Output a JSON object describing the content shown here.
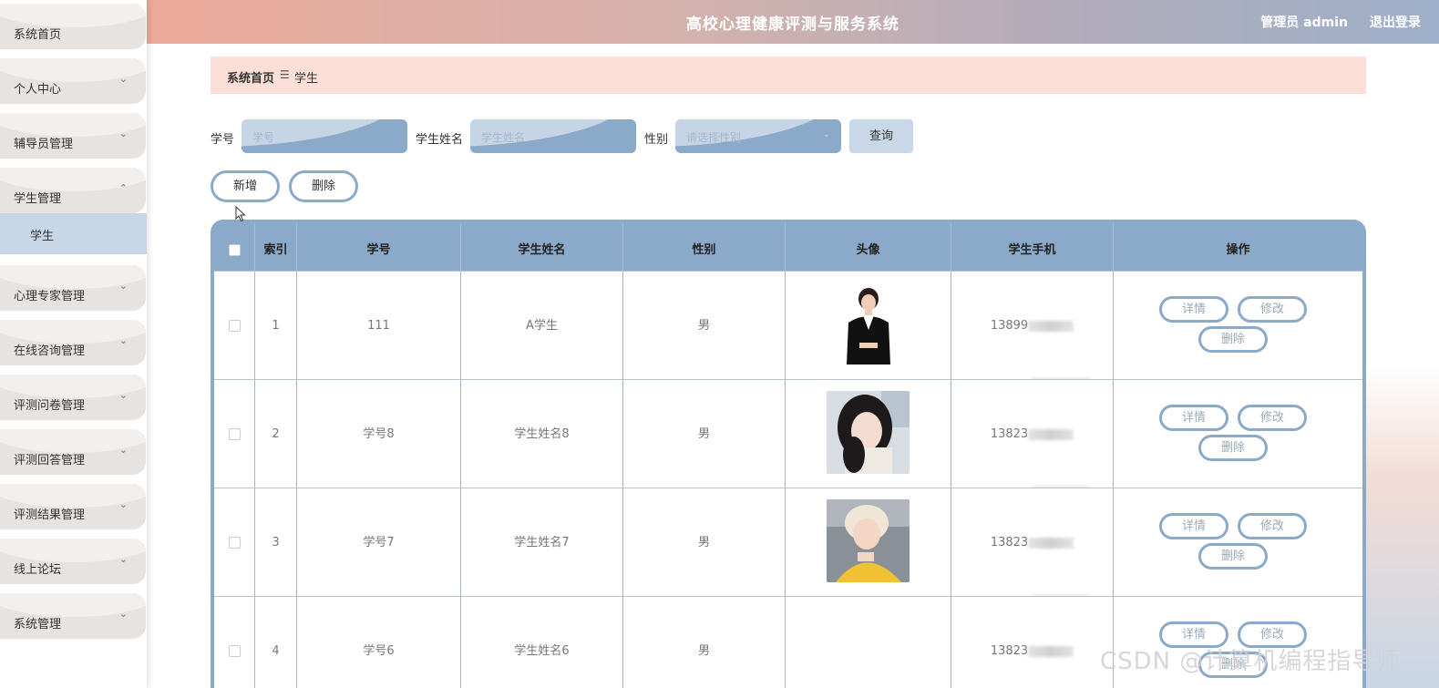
{
  "header": {
    "title": "高校心理健康评测与服务系统",
    "user": "管理员 admin",
    "logout": "退出登录"
  },
  "sidebar": {
    "items": [
      {
        "label": "系统首页",
        "chevron": ""
      },
      {
        "label": "个人中心",
        "chevron": "⌄"
      },
      {
        "label": "辅导员管理",
        "chevron": "⌄"
      },
      {
        "label": "学生管理",
        "chevron": "⌃"
      },
      {
        "label": "心理专家管理",
        "chevron": "⌄"
      },
      {
        "label": "在线咨询管理",
        "chevron": "⌄"
      },
      {
        "label": "评测问卷管理",
        "chevron": "⌄"
      },
      {
        "label": "评测回答管理",
        "chevron": "⌄"
      },
      {
        "label": "评测结果管理",
        "chevron": "⌄"
      },
      {
        "label": "线上论坛",
        "chevron": "⌄"
      },
      {
        "label": "系统管理",
        "chevron": "⌄"
      }
    ],
    "submenu": {
      "label": "学生"
    }
  },
  "breadcrumb": {
    "home": "系统首页",
    "separator": "☰",
    "current": "学生"
  },
  "search": {
    "id_label": "学号",
    "id_placeholder": "学号",
    "name_label": "学生姓名",
    "name_placeholder": "学生姓名",
    "gender_label": "性别",
    "gender_placeholder": "请选择性别",
    "query_label": "查询"
  },
  "actions": {
    "add_label": "新增",
    "delete_label": "删除"
  },
  "table": {
    "columns": [
      "",
      "索引",
      "学号",
      "学生姓名",
      "性别",
      "头像",
      "学生手机",
      "操作"
    ],
    "rows": [
      {
        "index": "1",
        "id": "111",
        "name": "A学生",
        "gender": "男",
        "phone": "13899"
      },
      {
        "index": "2",
        "id": "学号8",
        "name": "学生姓名8",
        "gender": "男",
        "phone": "13823"
      },
      {
        "index": "3",
        "id": "学号7",
        "name": "学生姓名7",
        "gender": "男",
        "phone": "13823"
      },
      {
        "index": "4",
        "id": "学号6",
        "name": "学生姓名6",
        "gender": "男",
        "phone": "13823"
      }
    ],
    "row_actions": {
      "detail": "详情",
      "edit": "修改",
      "delete": "删除"
    }
  },
  "watermark": "CSDN @计算机编程指导师",
  "colors": {
    "accent": "#8ba9c8",
    "breadcrumb_bg": "#fce0d8",
    "header_left": "#eba999",
    "header_right": "#9eb0ca"
  }
}
